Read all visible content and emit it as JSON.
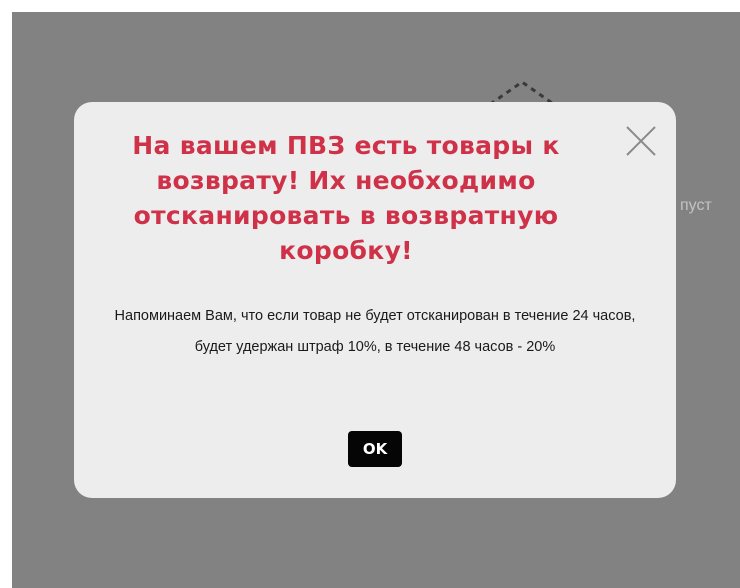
{
  "background": {
    "partial_text": "пуст",
    "overlay_color": "#828282"
  },
  "dialog": {
    "title": "На вашем ПВЗ есть товары к возврату! Их необходимо отсканировать в возвратную коробку!",
    "message": "Напоминаем Вам, что если товар не будет отсканирован в течение 24 часов, будет удержан штраф 10%, в течение 48 часов - 20%",
    "ok_label": "OK",
    "close_icon": "close-icon",
    "title_color": "#cf3148",
    "background_color": "#ededed"
  }
}
